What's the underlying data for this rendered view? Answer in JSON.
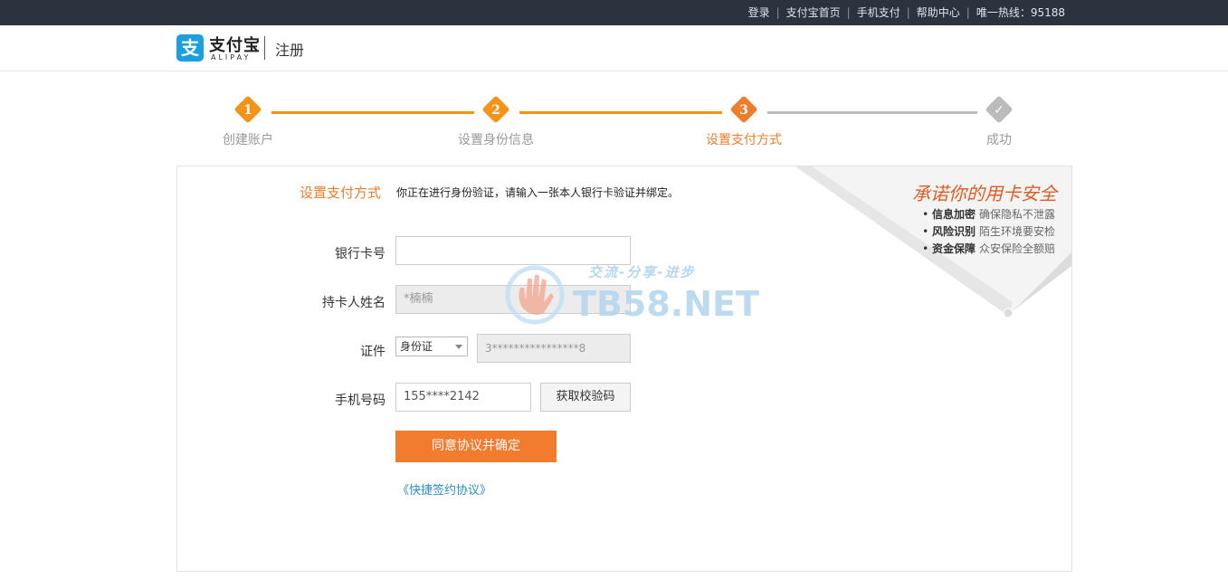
{
  "topnav": {
    "links": [
      "登录",
      "支付宝首页",
      "手机支付",
      "帮助中心"
    ],
    "hotline": "唯一热线：95188"
  },
  "header": {
    "logo_cn": "支付宝",
    "logo_en": "ALIPAY",
    "title": "注册"
  },
  "steps": [
    {
      "num": "1",
      "label": "创建账户"
    },
    {
      "num": "2",
      "label": "设置身份信息"
    },
    {
      "num": "3",
      "label": "设置支付方式"
    },
    {
      "num": "",
      "label": "成功"
    }
  ],
  "form": {
    "section_title": "设置支付方式",
    "section_desc": "你正在进行身份验证，请输入一张本人银行卡验证并绑定。",
    "card_label": "银行卡号",
    "card_value": "",
    "holder_label": "持卡人姓名",
    "holder_value": "*楠楠",
    "id_label": "证件",
    "id_type": "身份证",
    "id_value": "3****************8",
    "phone_label": "手机号码",
    "phone_value": "155****2142",
    "get_code": "获取校验码",
    "submit": "同意协议并确定",
    "agreement": "《快捷签约协议》"
  },
  "promo": {
    "title": "承诺你的用卡安全",
    "items": [
      {
        "key": "信息加密",
        "value": "确保隐私不泄露"
      },
      {
        "key": "风险识别",
        "value": "陌生环境要安检"
      },
      {
        "key": "资金保障",
        "value": "众安保险全额赔"
      }
    ]
  },
  "watermark": {
    "slogan": "交流-分享-进步",
    "site": "TB58.NET"
  },
  "colors": {
    "accent": "#f37b2d",
    "step_active": "#f39419",
    "step_current": "#f07d2a",
    "step_inactive": "#bbbbbb",
    "link": "#2a8ec7",
    "topbar": "#2d323f"
  }
}
